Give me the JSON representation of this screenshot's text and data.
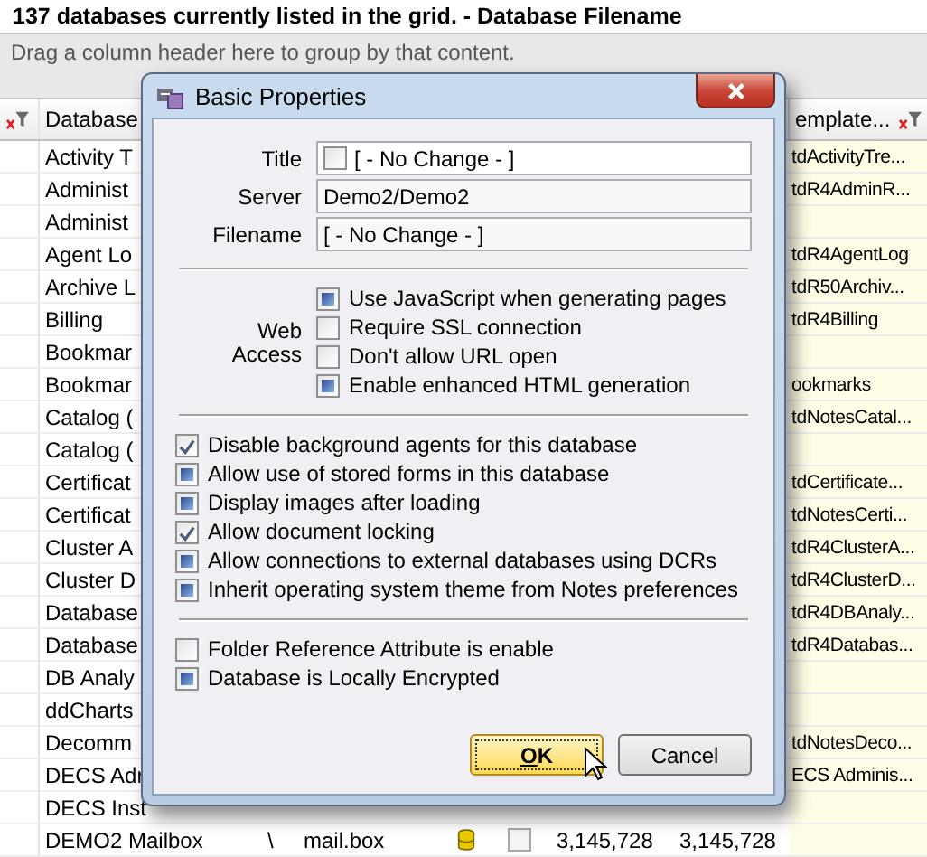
{
  "window": {
    "title": "137 databases currently listed in the grid. - Database Filename"
  },
  "group_panel": {
    "hint": "Drag a column header here to group by that content."
  },
  "grid": {
    "columns": [
      {
        "label": "Database"
      },
      {
        "label": "emplate..."
      }
    ],
    "rows": [
      {
        "name": "Activity T",
        "template": "tdActivityTre..."
      },
      {
        "name": "Administ",
        "template": "tdR4AdminR..."
      },
      {
        "name": "Administ"
      },
      {
        "name": "Agent Lo",
        "template": "tdR4AgentLog"
      },
      {
        "name": "Archive L",
        "template": "tdR50Archiv..."
      },
      {
        "name": "Billing",
        "template": "tdR4Billing"
      },
      {
        "name": "Bookmar"
      },
      {
        "name": "Bookmar",
        "template": "ookmarks"
      },
      {
        "name": "Catalog (",
        "template": "tdNotesCatal..."
      },
      {
        "name": "Catalog ("
      },
      {
        "name": "Certificat",
        "template": "tdCertificate..."
      },
      {
        "name": "Certificat",
        "template": "tdNotesCerti..."
      },
      {
        "name": "Cluster A",
        "template": "tdR4ClusterA..."
      },
      {
        "name": "Cluster D",
        "template": "tdR4ClusterD..."
      },
      {
        "name": "Database",
        "template": "tdR4DBAnaly..."
      },
      {
        "name": "Database",
        "template": "tdR4Databas..."
      },
      {
        "name": "DB Analy"
      },
      {
        "name": "ddCharts"
      },
      {
        "name": "Decomm",
        "template": "tdNotesDeco..."
      },
      {
        "name": "DECS Adr",
        "template": "ECS Adminis..."
      },
      {
        "name": "DECS Inst"
      },
      {
        "name": "DEMO2 Mailbox",
        "path": "\\",
        "filename": "mail.box",
        "checked": false,
        "size": "3,145,728",
        "size_2": "3,145,728"
      }
    ]
  },
  "dialog": {
    "title": "Basic Properties",
    "fields": [
      {
        "label": "Title",
        "value": "[ - No Change - ]",
        "checked": false,
        "indeterminate": false
      },
      {
        "label": "Server",
        "value": "Demo2/Demo2"
      },
      {
        "label": "Filename",
        "value": "[ - No Change - ]"
      }
    ],
    "web_access": {
      "label": "Web Access",
      "options": [
        {
          "label": "Use JavaScript when generating pages",
          "checked": false,
          "indeterminate": true
        },
        {
          "label": "Require SSL connection",
          "checked": false,
          "indeterminate": false
        },
        {
          "label": "Don't allow URL open",
          "checked": false,
          "indeterminate": false
        },
        {
          "label": "Enable enhanced HTML generation",
          "checked": false,
          "indeterminate": true
        }
      ]
    },
    "options": [
      {
        "label": "Disable background agents for this database",
        "checked": true,
        "indeterminate": false
      },
      {
        "label": "Allow use of stored forms in this database",
        "checked": false,
        "indeterminate": true
      },
      {
        "label": "Display images after loading",
        "checked": false,
        "indeterminate": true
      },
      {
        "label": "Allow document locking",
        "checked": true,
        "indeterminate": false
      },
      {
        "label": "Allow connections to external databases using DCRs",
        "checked": false,
        "indeterminate": true
      },
      {
        "label": "Inherit operating system theme from Notes preferences",
        "checked": false,
        "indeterminate": true
      }
    ],
    "flags": [
      {
        "label": "Folder Reference Attribute is enable",
        "checked": false,
        "indeterminate": false
      },
      {
        "label": "Database is Locally Encrypted",
        "checked": false,
        "indeterminate": true
      }
    ],
    "buttons": [
      {
        "label": "OK",
        "default": true
      },
      {
        "label": "Cancel",
        "default": false
      }
    ]
  }
}
